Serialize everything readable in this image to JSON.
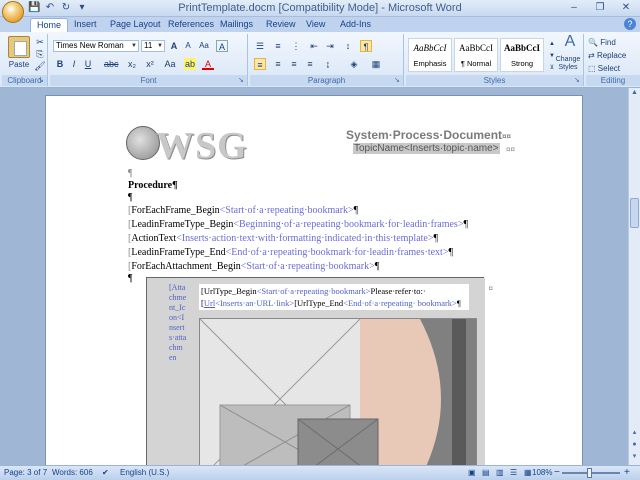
{
  "window": {
    "title": "PrintTemplate.docm [Compatibility Mode] - Microsoft Word",
    "minimize": "–",
    "restore": "❐",
    "close": "✕"
  },
  "qat": {
    "save": "💾",
    "undo": "↶",
    "redo": "↻",
    "more": "▾"
  },
  "tabs": [
    {
      "label": "Home",
      "active": true
    },
    {
      "label": "Insert"
    },
    {
      "label": "Page Layout"
    },
    {
      "label": "References"
    },
    {
      "label": "Mailings"
    },
    {
      "label": "Review"
    },
    {
      "label": "View"
    },
    {
      "label": "Add-Ins"
    }
  ],
  "ribbon": {
    "clipboard": {
      "label": "Clipboard",
      "paste": "Paste"
    },
    "font": {
      "label": "Font",
      "font_name": "Times New Roman",
      "font_size": "11",
      "grow": "A",
      "shrink": "A",
      "clear": "Aa",
      "bold": "B",
      "italic": "I",
      "underline": "U",
      "strike": "abc",
      "subscript": "x₂",
      "superscript": "x²",
      "change_case": "Aa",
      "highlight": "ab",
      "font_color": "A"
    },
    "paragraph": {
      "label": "Paragraph",
      "pilcrow": "¶"
    },
    "styles": {
      "label": "Styles",
      "items": [
        {
          "preview": "AaBbCcI",
          "name": "Emphasis"
        },
        {
          "preview": "AaBbCcI",
          "name": "¶ Normal"
        },
        {
          "preview": "AaBbCcI",
          "name": "Strong"
        }
      ],
      "change_styles": "Change Styles"
    },
    "editing": {
      "label": "Editing",
      "find": "Find",
      "replace": "Replace",
      "select": "Select"
    }
  },
  "document": {
    "logo_text": "WSG",
    "header_title": "System·Process·Document",
    "header_title_mark": "¤¤",
    "topic_field": "TopicName<Inserts·topic·name>",
    "topic_mark": "¤¤",
    "procedure": "Procedure¶",
    "pilcrow": "¶",
    "lines": [
      {
        "tag": "ForEachFrame_Begin",
        "desc": "<Start·of·a·repeating·bookmark>",
        "end": "¶"
      },
      {
        "tag": "LeadinFrameType_Begin",
        "desc": "<Beginning·of·a·repeating·bookmark·for·leadin·frames>",
        "end": "¶"
      },
      {
        "tag": "ActionText",
        "desc": "<Inserts·action·text·with·formatting·indicated·in·this·template>",
        "end": "¶"
      },
      {
        "tag": "LeadinFrameType_End",
        "desc": "<End·of·a·repeating·bookmark·for·leadin·frames·text>",
        "end": "¶"
      },
      {
        "tag": "ForEachAttachment_Begin",
        "desc": "<Start·of·a·repeating·bookmark>",
        "end": "¶"
      }
    ],
    "frame": {
      "narrow_col": "[Attachment_Ic on<Inserts·attachm en",
      "url_begin": "UrlType_Begin",
      "url_begin_desc": "<Start·of·a·repeating·bookmark>",
      "please_refer": "Please·refer·to:·",
      "url": "Url",
      "url_desc": "<Inserts·an·URL·link>",
      "url_end": "UrlType_End",
      "url_end_desc": "<End·of·a·repeating· bookmark>",
      "end_mark": "¶",
      "cell_mark": "¤"
    }
  },
  "status": {
    "page": "Page: 3 of 7",
    "words": "Words: 606",
    "language": "English (U.S.)",
    "zoom": "108%",
    "zoom_minus": "−",
    "zoom_plus": "+"
  },
  "colors": {
    "ribbon_bg": "#dbe8f8",
    "doc_bg": "#9fb6d4",
    "field_link": "#5060c8",
    "image_peach": "#e8c9b8",
    "image_dark": "#808080"
  }
}
